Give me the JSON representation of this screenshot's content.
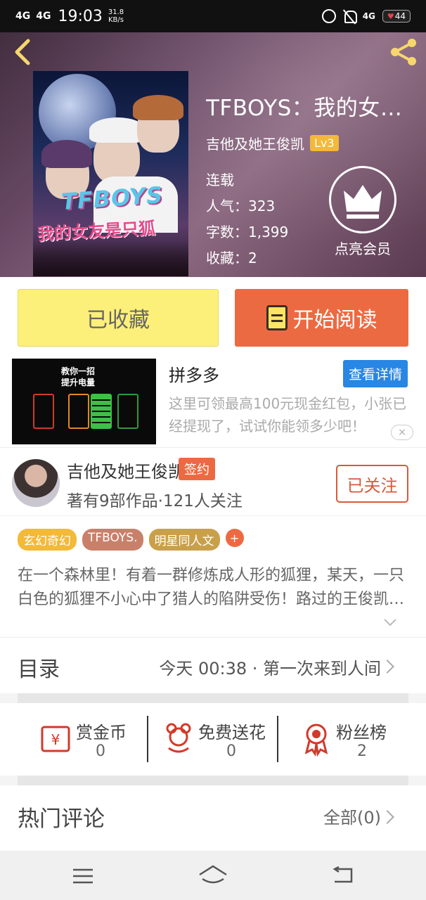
{
  "status_bar": {
    "signal_1": "4G",
    "signal_2": "4G",
    "time": "19:03",
    "speed_value": "31.8",
    "speed_unit": "KB/s",
    "net": "4G",
    "battery": "44"
  },
  "book": {
    "title": "TFBOYS：我的女友是…",
    "author": "吉他及她王俊凯",
    "level": "Lv3",
    "status": "连载",
    "popularity": "人气：323",
    "word_count": "字数：1,399",
    "favorites": "收藏：2",
    "cover_title": "TFBOYS",
    "cover_subtitle": "我的女友是只狐"
  },
  "vip": {
    "label": "点亮会员"
  },
  "actions": {
    "collected_label": "已收藏",
    "read_label": "开始阅读",
    "collected_color": "#fdf07a",
    "read_color": "#ec6a42"
  },
  "ad": {
    "image_line_1": "教你一招",
    "image_line_2": "提升电量",
    "name": "拼多多",
    "detail_label": "查看详情",
    "description": "这里可领最高100元现金红包，小张已经提现了，试试你能领多少吧！",
    "close": "×"
  },
  "author_card": {
    "name": "吉他及她王俊凯",
    "badge": "签约",
    "stats": "著有9部作品·121人关注",
    "follow_label": "已关注"
  },
  "tags": [
    {
      "label": "玄幻奇幻",
      "color": "#f3b938"
    },
    {
      "label": "TFBOYS.",
      "color": "#c9806a"
    },
    {
      "label": "明星同人文",
      "color": "#c9a04a"
    }
  ],
  "tag_add": "+",
  "description": "在一个森林里！有着一群修炼成人形的狐狸，某天，一只白色的狐狸不小心中了猎人的陷阱受伤！路过的王俊凯…",
  "catalog": {
    "label": "目录",
    "latest": "今天 00:38 · 第一次来到人间"
  },
  "rewards": [
    {
      "name": "赏金币",
      "value": "0",
      "icon": "coin-icon"
    },
    {
      "name": "免费送花",
      "value": "0",
      "icon": "flower-icon"
    },
    {
      "name": "粉丝榜",
      "value": "2",
      "icon": "medal-icon"
    }
  ],
  "comments": {
    "label": "热门评论",
    "all_label": "全部(0)"
  },
  "nav": {
    "menu": "menu-icon",
    "home": "home-icon",
    "back": "back-icon"
  }
}
